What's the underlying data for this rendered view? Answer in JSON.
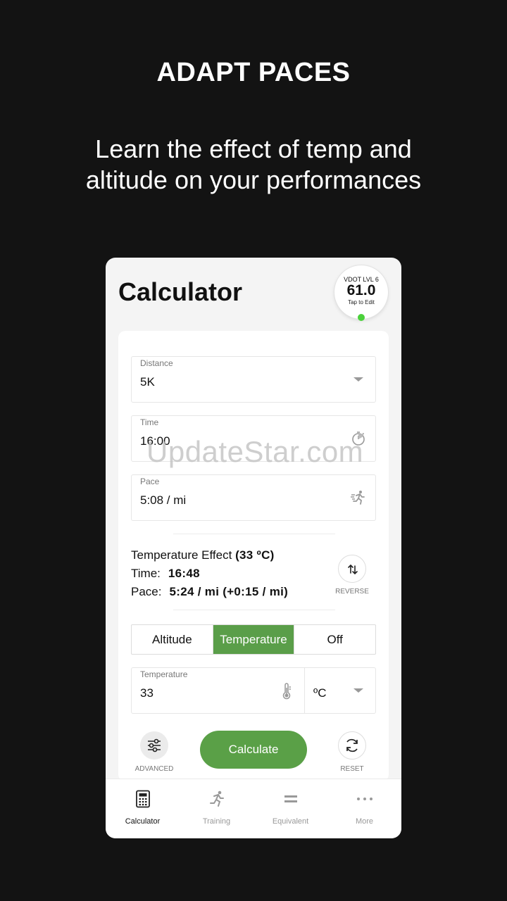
{
  "hero": {
    "title": "ADAPT PACES",
    "subtitle_line1": "Learn the effect of temp and",
    "subtitle_line2": "altitude on your performances"
  },
  "calculator": {
    "title": "Calculator",
    "vdot": {
      "level": "VDOT LVL 6",
      "value": "61.0",
      "tap_label": "Tap to Edit"
    },
    "distance": {
      "label": "Distance",
      "value": "5K"
    },
    "time": {
      "label": "Time",
      "value": "16:00"
    },
    "pace": {
      "label": "Pace",
      "value": "5:08 / mi"
    },
    "effect": {
      "heading": "Temperature Effect",
      "heading_value": "(33 ºC)",
      "time_label": "Time:",
      "time_value": "16:48",
      "pace_label": "Pace:",
      "pace_value": "5:24 / mi (+0:15 / mi)",
      "reverse_label": "REVERSE"
    },
    "segments": {
      "altitude": "Altitude",
      "temperature": "Temperature",
      "off": "Off"
    },
    "temperature": {
      "label": "Temperature",
      "value": "33",
      "unit": "ºC"
    },
    "advanced_label": "ADVANCED",
    "calculate_label": "Calculate",
    "reset_label": "RESET"
  },
  "tabs": [
    {
      "label": "Calculator",
      "icon": "calculator-icon"
    },
    {
      "label": "Training",
      "icon": "runner-icon"
    },
    {
      "label": "Equivalent",
      "icon": "equals-icon"
    },
    {
      "label": "More",
      "icon": "more-icon"
    }
  ],
  "watermark": "UpdateStar.com",
  "colors": {
    "accent": "#5aa047",
    "background": "#131313",
    "status_dot": "#4bd13b"
  }
}
